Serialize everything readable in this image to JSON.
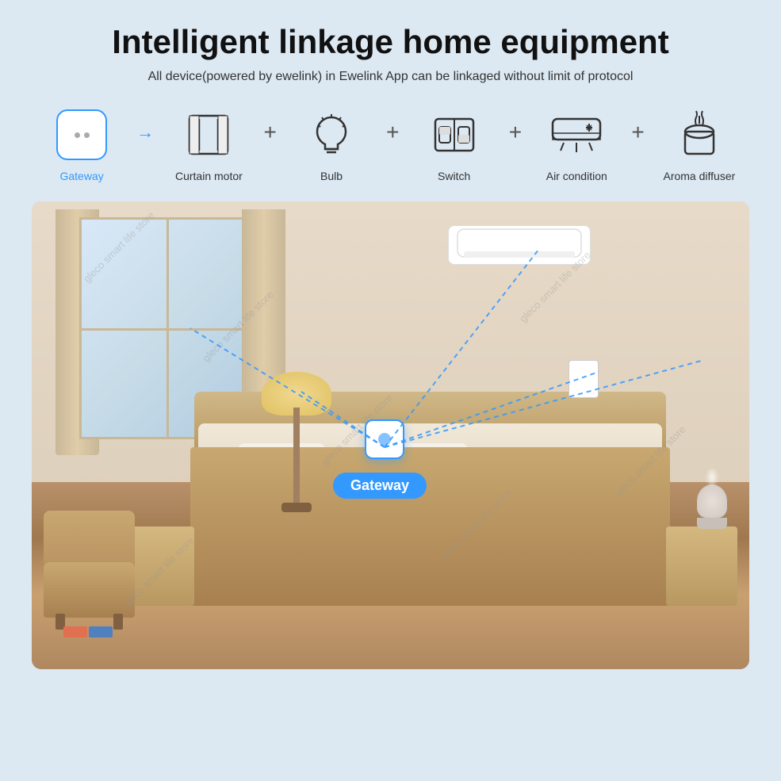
{
  "page": {
    "background_color": "#dce8f2"
  },
  "header": {
    "title": "Intelligent linkage home equipment",
    "subtitle": "All device(powered by ewelink) in Ewelink App can be linkaged without limit of protocol"
  },
  "devices": [
    {
      "id": "gateway",
      "label": "Gateway",
      "label_class": "blue",
      "icon": "gateway"
    },
    {
      "id": "curtain-motor",
      "label": "Curtain motor",
      "icon": "curtain"
    },
    {
      "id": "bulb",
      "label": "Bulb",
      "icon": "bulb"
    },
    {
      "id": "switch",
      "label": "Switch",
      "icon": "switch"
    },
    {
      "id": "air-condition",
      "label": "Air condition",
      "icon": "ac"
    },
    {
      "id": "aroma-diffuser",
      "label": "Aroma diffuser",
      "icon": "diffuser"
    }
  ],
  "room_label": "Gateway",
  "watermarks": [
    "gleco smart life store",
    "gleco smart life store",
    "gleco smart life store",
    "gleco smart life store",
    "gleco smart life store",
    "gleco smart life store",
    "gleco smart life store",
    "gleco smart life store"
  ]
}
